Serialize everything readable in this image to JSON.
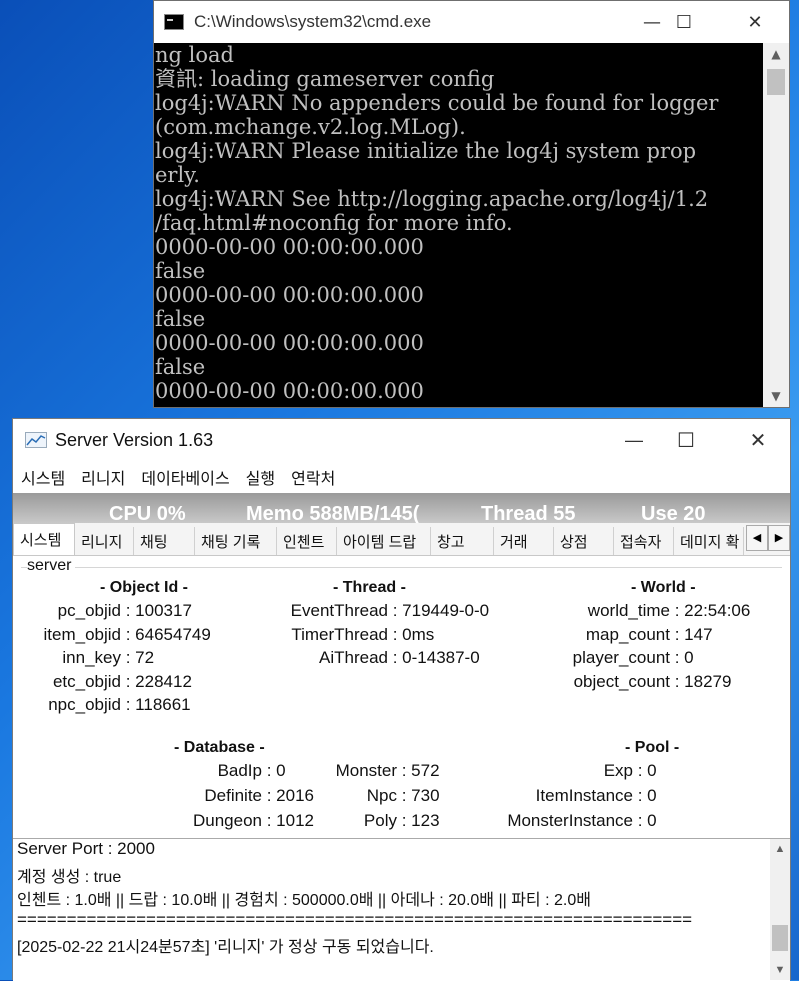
{
  "cmd": {
    "title": "C:\\Windows\\system32\\cmd.exe",
    "lines": [
      "ng load",
      "資訊: loading gameserver config",
      "log4j:WARN No appenders could be found for logger",
      "(com.mchange.v2.log.MLog).",
      "log4j:WARN Please initialize the log4j system prop",
      "erly.",
      "log4j:WARN See http://logging.apache.org/log4j/1.2",
      "/faq.html#noconfig for more info.",
      "0000-00-00 00:00:00.000",
      "false",
      "0000-00-00 00:00:00.000",
      "false",
      "0000-00-00 00:00:00.000",
      "false",
      "0000-00-00 00:00:00.000"
    ],
    "scroll_up": "▲",
    "scroll_down": "▼",
    "minimize": "—",
    "maximize": "☐",
    "close": "✕"
  },
  "server": {
    "title": "Server Version 1.63",
    "menu": [
      "시스템",
      "리니지",
      "데이타베이스",
      "실행",
      "연락처"
    ],
    "perf": {
      "cpu": "CPU 0%",
      "memo": "Memo 588MB/145(",
      "thread": "Thread 55",
      "use": "Use 20"
    },
    "tabs": [
      "시스템",
      "리니지",
      "채팅",
      "채팅 기록",
      "인첸트",
      "아이템 드랍",
      "창고",
      "거래",
      "상점",
      "접속자",
      "데미지 확"
    ],
    "tab_left": "◀",
    "tab_right": "▶",
    "group": "server",
    "object": {
      "header": "- Object Id -",
      "rows": [
        {
          "k": "pc_objid",
          "v": "100317"
        },
        {
          "k": "item_objid",
          "v": "64654749"
        },
        {
          "k": "inn_key",
          "v": "72"
        },
        {
          "k": "etc_objid",
          "v": "228412"
        },
        {
          "k": "npc_objid",
          "v": "118661"
        }
      ]
    },
    "thread": {
      "header": "- Thread -",
      "rows": [
        {
          "k": "EventThread",
          "v": "719449-0-0"
        },
        {
          "k": "TimerThread",
          "v": "0ms"
        },
        {
          "k": "AiThread",
          "v": "0-14387-0"
        }
      ]
    },
    "world": {
      "header": "- World -",
      "rows": [
        {
          "k": "world_time",
          "v": "22:54:06"
        },
        {
          "k": "map_count",
          "v": "147"
        },
        {
          "k": "player_count",
          "v": "0"
        },
        {
          "k": "object_count",
          "v": "18279"
        }
      ]
    },
    "database": {
      "header": "- Database -",
      "left": [
        {
          "k": "BadIp",
          "v": "0"
        },
        {
          "k": "Definite",
          "v": "2016"
        },
        {
          "k": "Dungeon",
          "v": "1012"
        }
      ],
      "right": [
        {
          "k": "Monster",
          "v": "572"
        },
        {
          "k": "Npc",
          "v": "730"
        },
        {
          "k": "Poly",
          "v": "123"
        }
      ]
    },
    "pool": {
      "header": "- Pool -",
      "rows": [
        {
          "k": "Exp",
          "v": "0"
        },
        {
          "k": "ItemInstance",
          "v": "0"
        },
        {
          "k": "MonsterInstance",
          "v": "0"
        }
      ]
    },
    "log": [
      "Server Port : 2000",
      "계정 생성 : true",
      "인첸트 : 1.0배  ||  드랍 : 10.0배  ||  경험치 : 500000.0배  ||  아데나 : 20.0배  ||  파티 : 2.0배",
      "====================================================================",
      "[2025-02-22 21시24분57초]  '리니지' 가 정상 구동 되었습니다."
    ],
    "minimize": "—",
    "maximize": "☐",
    "close": "✕"
  }
}
